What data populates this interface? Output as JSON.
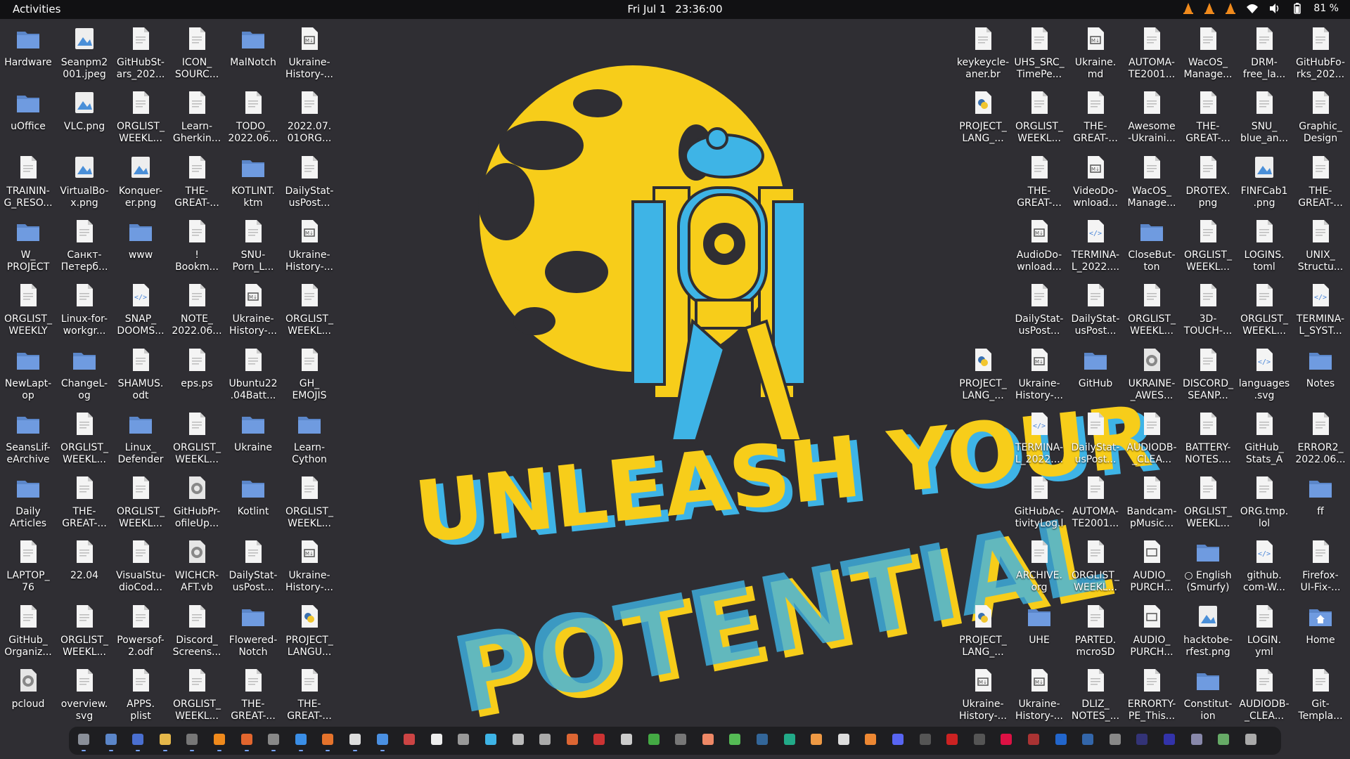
{
  "topbar": {
    "activities": "Activities",
    "date": "Fri Jul 1",
    "time": "23:36:00",
    "battery": "81 %"
  },
  "wallpaper": {
    "line1": "UNLEASH YOUR",
    "line2": "POTENTIAL",
    "colors": {
      "yellow": "#f7cd1a",
      "blue": "#3eb4e6",
      "bg": "#2f2e33"
    }
  },
  "left_icons": [
    [
      "Hardware",
      "Seanpm2\n001.jpeg",
      "GitHubSt-\nars_202...",
      "ICON_\nSOURC...",
      "MalNotch",
      "Ukraine-\nHistory-..."
    ],
    [
      "uOffice",
      "VLC.png",
      "ORGLIST_\nWEEKL...",
      "Learn-\nGherkin...",
      "TODO_\n2022.06...",
      "2022.07.\n01ORG..."
    ],
    [
      "TRAININ-\nG_RESO...",
      "VirtualBo-\nx.png",
      "Konquer-\ner.png",
      "THE-\nGREAT-...",
      "KOTLINT.\nktm",
      "DailyStat-\nusPost..."
    ],
    [
      "W_\nPROJECT",
      "Санкт-\nПетерб...",
      "www",
      "!\nBookm...",
      "SNU-\nPorn_L...",
      "Ukraine-\nHistory-..."
    ],
    [
      "ORGLIST_\nWEEKLY",
      "Linux-for-\nworkgr...",
      "SNAP_\nDOOMS...",
      "NOTE_\n2022.06...",
      "Ukraine-\nHistory-...",
      "ORGLIST_\nWEEKL..."
    ],
    [
      "NewLapt-\nop",
      "ChangeL-\nog",
      "SHAMUS.\nodt",
      "eps.ps",
      "Ubuntu22\n.04Batt...",
      "GH_\nEMOJIS"
    ],
    [
      "SeansLif-\neArchive",
      "ORGLIST_\nWEEKL...",
      "Linux_\nDefender",
      "ORGLIST_\nWEEKL...",
      "Ukraine",
      "Learn-\nCython"
    ],
    [
      "Daily\nArticles",
      "THE-\nGREAT-...",
      "ORGLIST_\nWEEKL...",
      "GitHubPr-\nofileUp...",
      "Kotlint",
      "ORGLIST_\nWEEKL..."
    ],
    [
      "LAPTOP_\n76",
      "22.04",
      "VisualStu-\ndioCod...",
      "WICHCR-\nAFT.vb",
      "DailyStat-\nusPost...",
      "Ukraine-\nHistory-..."
    ],
    [
      "GitHub_\nOrganiz...",
      "ORGLIST_\nWEEKL...",
      "Powersof-\n2.odf",
      "Discord_\nScreens...",
      "Flowered-\nNotch",
      "PROJECT_\nLANGU..."
    ],
    [
      "pcloud",
      "overview.\nsvg",
      "APPS.\nplist",
      "ORGLIST_\nWEEKL...",
      "THE-\nGREAT-...",
      "THE-\nGREAT-..."
    ]
  ],
  "right_icons": [
    [
      "keykeycle-\naner.br",
      "UHS_SRC_\nTimePe...",
      "Ukraine.\nmd",
      "AUTOMA-\nTE2001...",
      "WacOS_\nManage...",
      "DRM-\nfree_la...",
      "GitHubFo-\nrks_202..."
    ],
    [
      "PROJECT_\nLANG_...",
      "ORGLIST_\nWEEKL...",
      "THE-\nGREAT-...",
      "Awesome\n-Ukraini...",
      "THE-\nGREAT-...",
      "SNU_\nblue_an...",
      "Graphic_\nDesign"
    ],
    [
      "THE-\nGREAT-...",
      "VideoDo-\nwnload...",
      "WacOS_\nManage...",
      "DROTEX.\npng",
      "FINFCab1\n.png",
      "THE-\nGREAT-..."
    ],
    [
      "AudioDo-\nwnload...",
      "TERMINA-\nL_2022....",
      "CloseBut-\nton",
      "ORGLIST_\nWEEKL...",
      "LOGINS.\ntoml",
      "UNIX_\nStructu..."
    ],
    [
      "DailyStat-\nusPost...",
      "DailyStat-\nusPost...",
      "ORGLIST_\nWEEKL...",
      "3D-\nTOUCH-...",
      "ORGLIST_\nWEEKL...",
      "TERMINA-\nL_SYST..."
    ],
    [
      "PROJECT_\nLANG_...",
      "Ukraine-\nHistory-...",
      "GitHub",
      "UKRAINE-\n_AWES...",
      "DISCORD_\nSEANP...",
      "languages\n.svg",
      "Notes"
    ],
    [
      "TERMINA-\nL_2022....",
      "DailyStat-\nusPost...",
      "AUDIODB-\n_CLEA...",
      "BATTERY-\nNOTES....",
      "GitHub_\nStats_A",
      "ERROR2_\n2022.06..."
    ],
    [
      "GitHubAc-\ntivityLog.l",
      "AUTOMA-\nTE2001...",
      "Bandcam-\npMusic...",
      "ORGLIST_\nWEEKL...",
      "ORG.tmp.\nlol",
      "ff"
    ],
    [
      "ARCHIVE.\norg",
      "ORGLIST_\nWEEKL...",
      "AUDIO_\nPURCH...",
      "○ English\n(Smurfy)",
      "github.\ncom-W...",
      "Firefox-\nUI-Fix-..."
    ],
    [
      "PROJECT_\nLANG_...",
      "UHE",
      "PARTED.\nmcroSD",
      "AUDIO_\nPURCH...",
      "hacktobe-\nrfest.png",
      "LOGIN.\nyml",
      "Home"
    ],
    [
      "Ukraine-\nHistory-...",
      "Ukraine-\nHistory-...",
      "DLIZ_\nNOTES_...",
      "ERRORTY-\nPE_This...",
      "Constitut-\nion",
      "AUDIODB-\n_CLEA...",
      "Git-\nTempla..."
    ]
  ],
  "icon_kinds": {
    "folder": "folder-icon",
    "document": "document-icon",
    "image": "image-icon",
    "markdown": "markdown-icon",
    "code": "code-icon",
    "python": "python-icon",
    "settings": "gear-icon",
    "audio": "audio-icon",
    "home": "home-icon"
  },
  "dock_count": 44
}
